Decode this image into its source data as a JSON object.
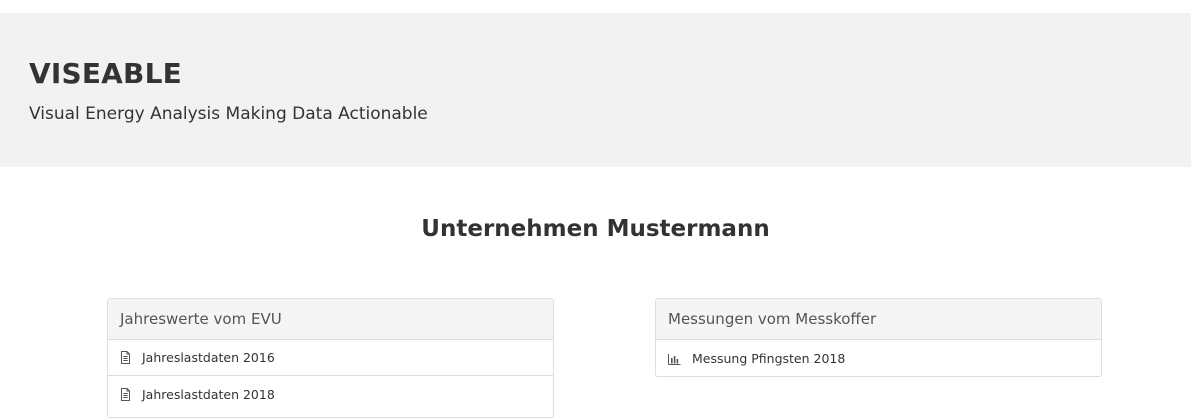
{
  "header": {
    "title": "VISEABLE",
    "subtitle": "Visual Energy Analysis Making Data Actionable"
  },
  "company": {
    "name": "Unternehmen Mustermann"
  },
  "panels": [
    {
      "heading": "Jahreswerte vom EVU",
      "items": [
        {
          "label": "Jahreslastdaten 2016",
          "icon": "file-icon"
        },
        {
          "label": "Jahreslastdaten 2018",
          "icon": "file-icon"
        }
      ]
    },
    {
      "heading": "Messungen vom Messkoffer",
      "items": [
        {
          "label": "Messung Pfingsten 2018",
          "icon": "bar-chart-icon"
        }
      ]
    }
  ]
}
